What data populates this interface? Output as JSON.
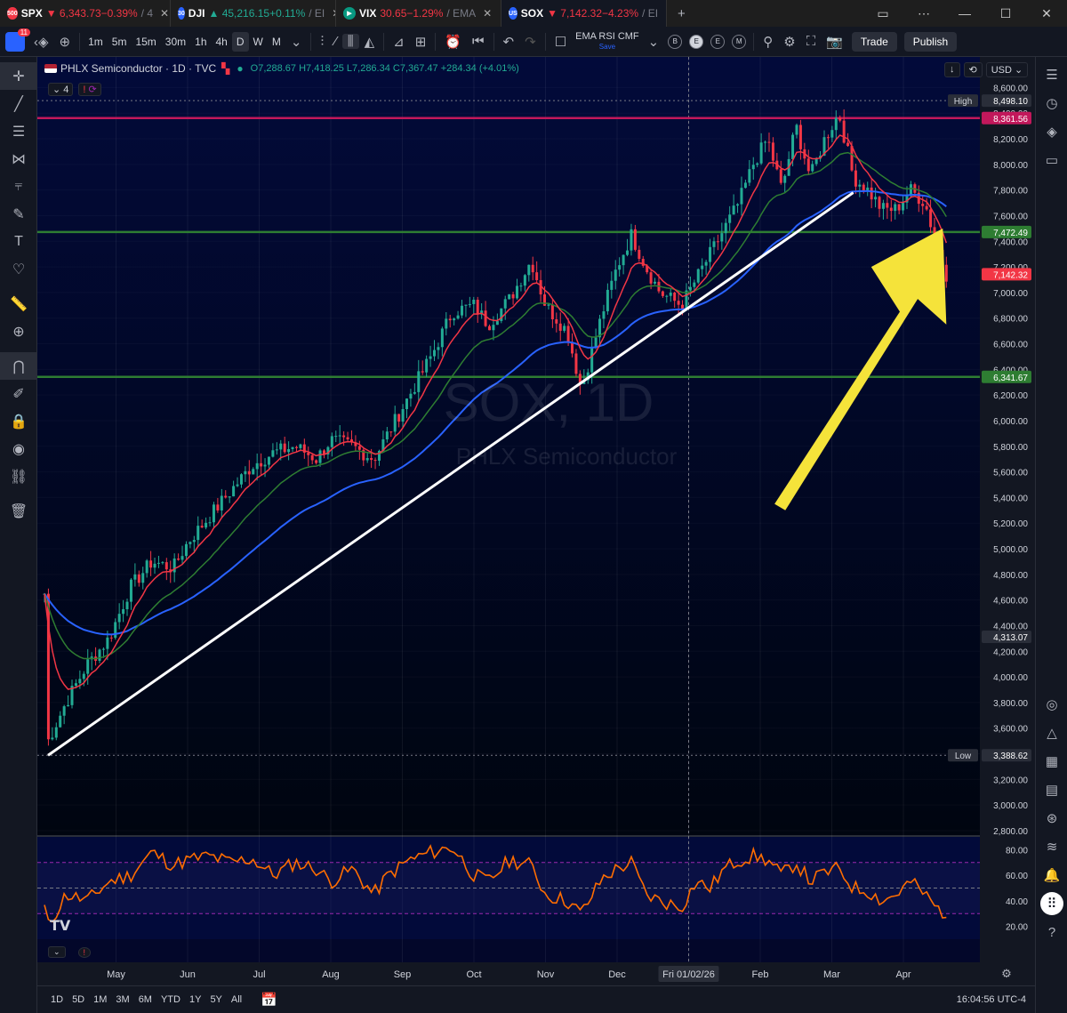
{
  "tabs": [
    {
      "badge": "500",
      "badge_color": "#f23645",
      "symbol": "SPX",
      "dir": "▼",
      "price": "6,343.73",
      "change": "−0.39%",
      "rest": "/ 4",
      "trend": "dn"
    },
    {
      "badge": "30",
      "badge_color": "#2962ff",
      "symbol": "DJI",
      "dir": "▲",
      "price": "45,216.15",
      "change": "+0.11%",
      "rest": "/ EI",
      "trend": "up"
    },
    {
      "badge": "▶",
      "badge_color": "#089981",
      "symbol": "VIX",
      "dir": "",
      "price": "30.65",
      "change": "−1.29%",
      "rest": "/ EMA",
      "trend": "dn"
    },
    {
      "badge": "US",
      "badge_color": "#2962ff",
      "symbol": "SOX",
      "dir": "▼",
      "price": "7,142.32",
      "change": "−4.23%",
      "rest": "/ EI",
      "trend": "dn"
    }
  ],
  "toolbar": {
    "avatar_badge": "11",
    "intervals": [
      "1m",
      "5m",
      "15m",
      "30m",
      "1h",
      "4h",
      "D",
      "W",
      "M"
    ],
    "selected_interval": "D",
    "indicators_label": "EMA RSI CMF",
    "indicators_sub": "Save",
    "pills": [
      "B",
      "E",
      "E",
      "M"
    ],
    "trade_label": "Trade",
    "publish_label": "Publish"
  },
  "legend": {
    "title": "PHLX Semiconductor · 1D · TVC",
    "ohlc": "O7,288.67 H7,418.25 L7,286.34 C7,367.47 +284.34 (+4.01%)",
    "indicators_count": "4",
    "currency": "USD"
  },
  "bottom": {
    "timeframes": [
      "1D",
      "5D",
      "1M",
      "3M",
      "6M",
      "YTD",
      "1Y",
      "5Y",
      "All"
    ],
    "clock": "16:04:56 UTC-4"
  },
  "watermark": {
    "line1": "SOX, 1D",
    "line2": "PHLX Semiconductor"
  },
  "colors": {
    "bg": "#020a2c",
    "ema_fast": "#f23645",
    "ema_mid": "#2e7d32",
    "ema_slow": "#2962ff",
    "trend": "#ffffff",
    "arrow": "#f5e33a",
    "rsi": "#ff6d00",
    "hline_magenta": "#c2185b",
    "hline_green": "#2e7d32"
  },
  "chart_data": {
    "type": "candlestick",
    "title": "PHLX Semiconductor",
    "symbol": "SOX",
    "interval": "1D",
    "ylim": [
      2800,
      8700
    ],
    "y_ticks": [
      2800,
      3000,
      3200,
      3400,
      3600,
      3800,
      4000,
      4200,
      4400,
      4600,
      4800,
      5000,
      5200,
      5400,
      5600,
      5800,
      6000,
      6200,
      6400,
      6600,
      6800,
      7000,
      7200,
      7400,
      7600,
      7800,
      8000,
      8200,
      8400,
      8600
    ],
    "x_labels": [
      "May",
      "Jun",
      "Jul",
      "Aug",
      "Sep",
      "Oct",
      "Nov",
      "Dec",
      "Fri 01/02/26",
      "Feb",
      "Mar",
      "Apr"
    ],
    "price_markers": [
      {
        "label": "High",
        "value": 8498.1,
        "text": "8,498.10"
      },
      {
        "label": "",
        "value": 8361.56,
        "text": "8,361.56"
      },
      {
        "label": "",
        "value": 7472.49,
        "text": "7,472.49"
      },
      {
        "label": "",
        "value": 7142.32,
        "text": "7,142.32"
      },
      {
        "label": "",
        "value": 6341.67,
        "text": "6,341.67"
      },
      {
        "label": "",
        "value": 4313.07,
        "text": "4,313.07"
      },
      {
        "label": "Low",
        "value": 3388.62,
        "text": "3,388.62"
      }
    ],
    "horizontal_lines": [
      8361.56,
      7472.49,
      6341.67
    ],
    "trendline": {
      "from": {
        "month": 0.05,
        "price": 3388
      },
      "to": {
        "month": 11.3,
        "price": 7780
      }
    },
    "close_path": [
      [
        0.0,
        4650
      ],
      [
        0.05,
        3500
      ],
      [
        0.3,
        3800
      ],
      [
        0.6,
        4100
      ],
      [
        0.9,
        4300
      ],
      [
        1.2,
        4700
      ],
      [
        1.5,
        4900
      ],
      [
        1.8,
        4850
      ],
      [
        2.0,
        5050
      ],
      [
        2.3,
        5250
      ],
      [
        2.6,
        5450
      ],
      [
        2.9,
        5650
      ],
      [
        3.2,
        5750
      ],
      [
        3.5,
        5800
      ],
      [
        3.8,
        5700
      ],
      [
        4.0,
        5850
      ],
      [
        4.3,
        5800
      ],
      [
        4.6,
        5700
      ],
      [
        4.8,
        5900
      ],
      [
        5.1,
        6200
      ],
      [
        5.4,
        6500
      ],
      [
        5.7,
        6850
      ],
      [
        6.0,
        6900
      ],
      [
        6.2,
        6750
      ],
      [
        6.5,
        6950
      ],
      [
        6.8,
        7250
      ],
      [
        7.0,
        6900
      ],
      [
        7.3,
        6700
      ],
      [
        7.5,
        6250
      ],
      [
        7.8,
        6850
      ],
      [
        8.0,
        7200
      ],
      [
        8.2,
        7450
      ],
      [
        8.4,
        7200
      ],
      [
        8.6,
        7000
      ],
      [
        8.9,
        6900
      ],
      [
        9.1,
        7100
      ],
      [
        9.3,
        7300
      ],
      [
        9.5,
        7500
      ],
      [
        9.7,
        7700
      ],
      [
        9.9,
        8000
      ],
      [
        10.1,
        8200
      ],
      [
        10.3,
        7800
      ],
      [
        10.5,
        8300
      ],
      [
        10.7,
        7900
      ],
      [
        10.9,
        8200
      ],
      [
        11.1,
        8400
      ],
      [
        11.3,
        7900
      ],
      [
        11.5,
        7800
      ],
      [
        11.7,
        7650
      ],
      [
        11.9,
        7650
      ],
      [
        12.1,
        7800
      ],
      [
        12.3,
        7700
      ],
      [
        12.45,
        7400
      ],
      [
        12.6,
        7142
      ]
    ],
    "rsi": {
      "ylim": [
        10,
        90
      ],
      "y_ticks": [
        20,
        40,
        60,
        80
      ],
      "levels": [
        70,
        30
      ],
      "mid": 50,
      "path": [
        [
          0.0,
          35
        ],
        [
          0.05,
          20
        ],
        [
          0.3,
          45
        ],
        [
          0.6,
          40
        ],
        [
          0.9,
          55
        ],
        [
          1.2,
          60
        ],
        [
          1.5,
          78
        ],
        [
          1.8,
          68
        ],
        [
          2.0,
          72
        ],
        [
          2.3,
          75
        ],
        [
          2.6,
          70
        ],
        [
          2.9,
          73
        ],
        [
          3.2,
          60
        ],
        [
          3.5,
          70
        ],
        [
          3.8,
          65
        ],
        [
          4.0,
          55
        ],
        [
          4.3,
          65
        ],
        [
          4.6,
          45
        ],
        [
          4.8,
          60
        ],
        [
          5.1,
          72
        ],
        [
          5.4,
          78
        ],
        [
          5.7,
          82
        ],
        [
          6.0,
          60
        ],
        [
          6.2,
          55
        ],
        [
          6.5,
          72
        ],
        [
          6.8,
          68
        ],
        [
          7.0,
          45
        ],
        [
          7.3,
          40
        ],
        [
          7.5,
          30
        ],
        [
          7.8,
          58
        ],
        [
          8.0,
          65
        ],
        [
          8.2,
          70
        ],
        [
          8.4,
          45
        ],
        [
          8.6,
          40
        ],
        [
          8.9,
          35
        ],
        [
          9.1,
          55
        ],
        [
          9.3,
          50
        ],
        [
          9.5,
          65
        ],
        [
          9.7,
          72
        ],
        [
          9.9,
          75
        ],
        [
          10.1,
          72
        ],
        [
          10.3,
          60
        ],
        [
          10.5,
          70
        ],
        [
          10.7,
          55
        ],
        [
          10.9,
          62
        ],
        [
          11.1,
          65
        ],
        [
          11.3,
          50
        ],
        [
          11.5,
          48
        ],
        [
          11.7,
          40
        ],
        [
          11.9,
          45
        ],
        [
          12.1,
          55
        ],
        [
          12.3,
          45
        ],
        [
          12.45,
          35
        ],
        [
          12.6,
          30
        ]
      ]
    }
  }
}
